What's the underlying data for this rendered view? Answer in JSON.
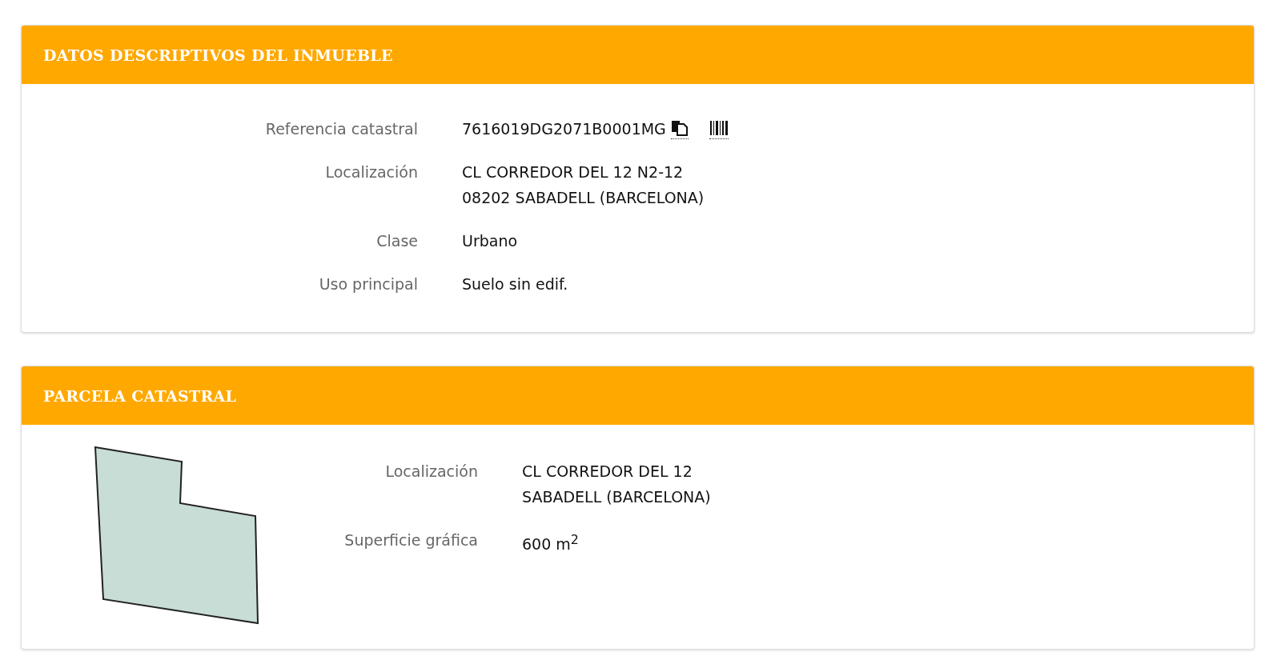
{
  "sections": [
    {
      "kind": "fields",
      "title": "DATOS DESCRIPTIVOS DEL INMUEBLE",
      "rows": [
        {
          "label": "Referencia catastral",
          "lines": [
            "7616019DG2071B0001MG"
          ],
          "actions": true
        },
        {
          "label": "Localización",
          "lines": [
            "CL CORREDOR DEL 12 N2-12",
            "08202 SABADELL (BARCELONA)"
          ]
        },
        {
          "label": "Clase",
          "lines": [
            "Urbano"
          ]
        },
        {
          "label": "Uso principal",
          "lines": [
            "Suelo sin edif."
          ]
        }
      ]
    },
    {
      "kind": "parcel",
      "title": "PARCELA CATASTRAL",
      "rows": [
        {
          "label": "Localización",
          "lines": [
            "CL CORREDOR DEL 12",
            "SABADELL (BARCELONA)"
          ]
        },
        {
          "label": "Superficie gráfica",
          "lines": [
            "600 m$^{2}$"
          ]
        }
      ]
    }
  ]
}
